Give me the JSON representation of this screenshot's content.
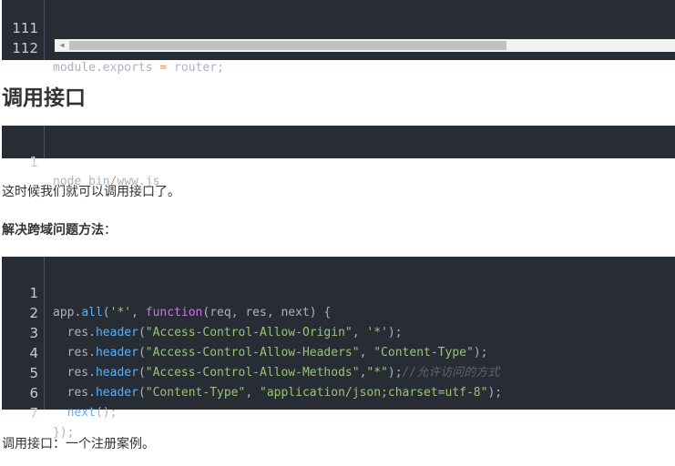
{
  "code_block_1": {
    "lines": [
      {
        "num": "111",
        "text": ""
      },
      {
        "num": "112",
        "text": "module.exports = router;"
      }
    ]
  },
  "section_heading": "调用接口",
  "code_block_2": {
    "lines": [
      {
        "num": "1",
        "text": "node bin/www.js"
      }
    ]
  },
  "para_1": "这时候我们就可以调用接口了。",
  "para_2_bold": "解决跨域问题方法",
  "para_2_colon": "：",
  "code_block_3": {
    "line_numbers": [
      "1",
      "2",
      "3",
      "4",
      "5",
      "6",
      "7"
    ]
  },
  "para_3": "调用接口：一个注册案例。"
}
